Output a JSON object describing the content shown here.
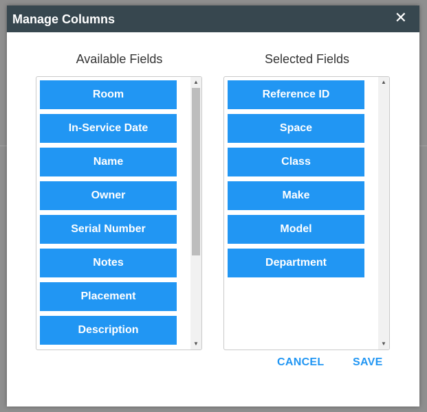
{
  "dialog": {
    "title": "Manage Columns",
    "close_glyph": "✕"
  },
  "available": {
    "heading": "Available Fields",
    "items": [
      "Room",
      "In-Service Date",
      "Name",
      "Owner",
      "Serial Number",
      "Notes",
      "Placement",
      "Description"
    ]
  },
  "selected": {
    "heading": "Selected Fields",
    "items": [
      "Reference ID",
      "Space",
      "Class",
      "Make",
      "Model",
      "Department"
    ]
  },
  "actions": {
    "cancel_label": "CANCEL",
    "save_label": "SAVE"
  },
  "colors": {
    "titlebar": "#37474f",
    "field_button": "#2196f3",
    "action_text": "#2196f3"
  },
  "icons": {
    "close": "close-icon",
    "scroll_up": "arrow-up-icon",
    "scroll_down": "arrow-down-icon"
  }
}
